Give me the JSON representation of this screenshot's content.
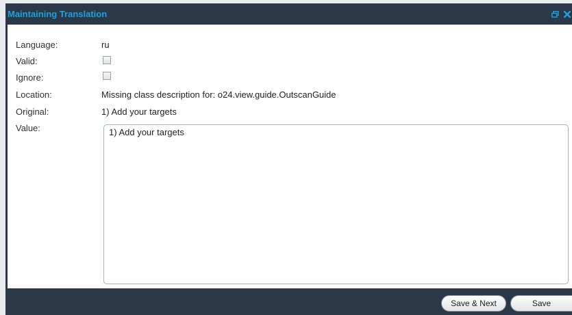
{
  "dialog": {
    "title": "Maintaining Translation",
    "icons": [
      "restore-icon",
      "close-icon"
    ],
    "title_color": "#1ba3e0",
    "frame_color": "#2b3847"
  },
  "form": {
    "language_label": "Language:",
    "language_value": "ru",
    "valid_label": "Valid:",
    "valid_checked": false,
    "ignore_label": "Ignore:",
    "ignore_checked": false,
    "location_label": "Location:",
    "location_value": "Missing class description for: o24.view.guide.OutscanGuide",
    "original_label": "Original:",
    "original_value": "1) Add your targets",
    "value_label": "Value:",
    "value_text": "1) Add your targets"
  },
  "buttons": {
    "save_next": "Save & Next",
    "save": "Save"
  }
}
